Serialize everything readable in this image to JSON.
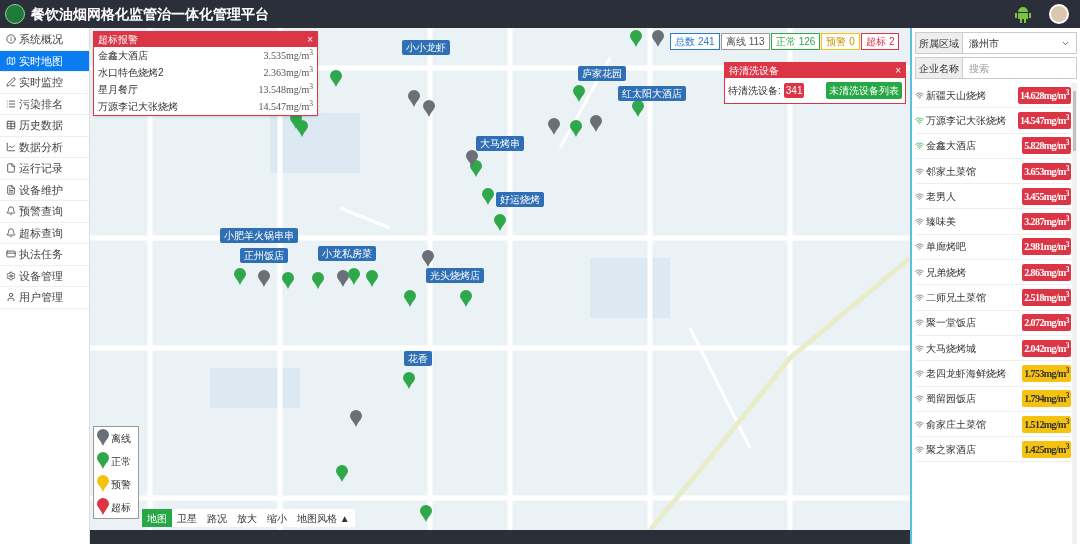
{
  "header": {
    "title": "餐饮油烟网格化监管治一体化管理平台"
  },
  "sidebar": {
    "items": [
      {
        "label": "系统概况",
        "selected": false
      },
      {
        "label": "实时地图",
        "selected": true
      },
      {
        "label": "实时监控",
        "selected": false
      },
      {
        "label": "污染排名",
        "selected": false
      },
      {
        "label": "历史数据",
        "selected": false
      },
      {
        "label": "数据分析",
        "selected": false
      },
      {
        "label": "运行记录",
        "selected": false
      },
      {
        "label": "设备维护",
        "selected": false
      },
      {
        "label": "预警查询",
        "selected": false
      },
      {
        "label": "超标查询",
        "selected": false
      },
      {
        "label": "执法任务",
        "selected": false
      },
      {
        "label": "设备管理",
        "selected": false
      },
      {
        "label": "用户管理",
        "selected": false
      }
    ]
  },
  "alert_panel": {
    "title": "超标报警",
    "close": "×",
    "rows": [
      {
        "name": "金鑫大酒店",
        "value": "3.535mg/m$^{3}$"
      },
      {
        "name": "水口特色烧烤2",
        "value": "2.363mg/m$^{3}$"
      },
      {
        "name": "星月餐厅",
        "value": "13.548mg/m$^{3}$"
      },
      {
        "name": "万源李记大张烧烤",
        "value": "14.547mg/m$^{3}$"
      }
    ]
  },
  "stats": [
    {
      "label": "总数",
      "count": "241",
      "kind": "total"
    },
    {
      "label": "离线",
      "count": "113",
      "kind": "offline"
    },
    {
      "label": "正常",
      "count": "126",
      "kind": "normal"
    },
    {
      "label": "预警",
      "count": "0",
      "kind": "warning"
    },
    {
      "label": "超标",
      "count": "2",
      "kind": "over"
    }
  ],
  "cleaning_panel": {
    "title": "待清洗设备",
    "close": "×",
    "label": "待清洗设备:",
    "count": "341",
    "button": "未清洗设备列表"
  },
  "map_labels": [
    "小小龙虾",
    "庐家花园",
    "红太阳大酒店",
    "大马烤串",
    "好运烧烤",
    "小肥羊火锅串串",
    "正州饭店",
    "小龙私房菜",
    "光头烧烤店",
    "花香"
  ],
  "pins": [
    {
      "kind": "normal"
    },
    {
      "kind": "normal"
    },
    {
      "kind": "offline"
    },
    {
      "kind": "normal"
    },
    {
      "kind": "offline"
    },
    {
      "kind": "offline"
    },
    {
      "kind": "normal"
    },
    {
      "kind": "normal"
    },
    {
      "kind": "offline"
    },
    {
      "kind": "normal"
    },
    {
      "kind": "normal"
    },
    {
      "kind": "offline"
    },
    {
      "kind": "offline"
    },
    {
      "kind": "normal"
    },
    {
      "kind": "normal"
    },
    {
      "kind": "normal"
    },
    {
      "kind": "offline"
    },
    {
      "kind": "normal"
    },
    {
      "kind": "normal"
    },
    {
      "kind": "offline"
    },
    {
      "kind": "normal"
    },
    {
      "kind": "normal"
    },
    {
      "kind": "offline"
    },
    {
      "kind": "normal"
    },
    {
      "kind": "normal"
    },
    {
      "kind": "normal"
    },
    {
      "kind": "offline"
    },
    {
      "kind": "normal"
    },
    {
      "kind": "normal"
    },
    {
      "kind": "normal"
    }
  ],
  "legend": [
    {
      "label": "离线",
      "kind": "offline"
    },
    {
      "label": "正常",
      "kind": "normal"
    },
    {
      "label": "预警",
      "kind": "warning"
    },
    {
      "label": "超标",
      "kind": "over"
    }
  ],
  "map_toolbar": [
    {
      "label": "地图",
      "selected": true
    },
    {
      "label": "卫星",
      "selected": false
    },
    {
      "label": "路况",
      "selected": false
    },
    {
      "label": "放大",
      "selected": false
    },
    {
      "label": "缩小",
      "selected": false
    },
    {
      "label": "地图风格 ▲",
      "selected": false
    }
  ],
  "filters": {
    "region_label": "所属区域",
    "region_value": "滁州市",
    "name_label": "企业名称",
    "name_placeholder": "搜索"
  },
  "ranking": [
    {
      "name": "新疆天山烧烤",
      "value": "14.628mg/m$^{3}$",
      "kind": "over",
      "online": false
    },
    {
      "name": "万源李记大张烧烤",
      "value": "14.547mg/m$^{3}$",
      "kind": "over",
      "online": true
    },
    {
      "name": "金鑫大酒店",
      "value": "5.828mg/m$^{3}$",
      "kind": "over",
      "online": true
    },
    {
      "name": "邻家土菜馆",
      "value": "3.653mg/m$^{3}$",
      "kind": "over",
      "online": false
    },
    {
      "name": "老男人",
      "value": "3.455mg/m$^{3}$",
      "kind": "over",
      "online": false
    },
    {
      "name": "臻味美",
      "value": "3.287mg/m$^{3}$",
      "kind": "over",
      "online": false
    },
    {
      "name": "单廊烤吧",
      "value": "2.981mg/m$^{3}$",
      "kind": "over",
      "online": false
    },
    {
      "name": "兄弟烧烤",
      "value": "2.863mg/m$^{3}$",
      "kind": "over",
      "online": false
    },
    {
      "name": "二师兄土菜馆",
      "value": "2.518mg/m$^{3}$",
      "kind": "over",
      "online": false
    },
    {
      "name": "聚一堂饭店",
      "value": "2.072mg/m$^{3}$",
      "kind": "over",
      "online": false
    },
    {
      "name": "大马烧烤城",
      "value": "2.042mg/m$^{3}$",
      "kind": "over",
      "online": false
    },
    {
      "name": "老四龙虾海鲜烧烤",
      "value": "1.753mg/m$^{3}$",
      "kind": "warning",
      "online": false
    },
    {
      "name": "蜀留园饭店",
      "value": "1.794mg/m$^{3}$",
      "kind": "warning",
      "online": false
    },
    {
      "name": "俞家庄土菜馆",
      "value": "1.512mg/m$^{3}$",
      "kind": "warning",
      "online": false
    },
    {
      "name": "聚之家酒店",
      "value": "1.425mg/m$^{3}$",
      "kind": "warning",
      "online": false
    }
  ]
}
